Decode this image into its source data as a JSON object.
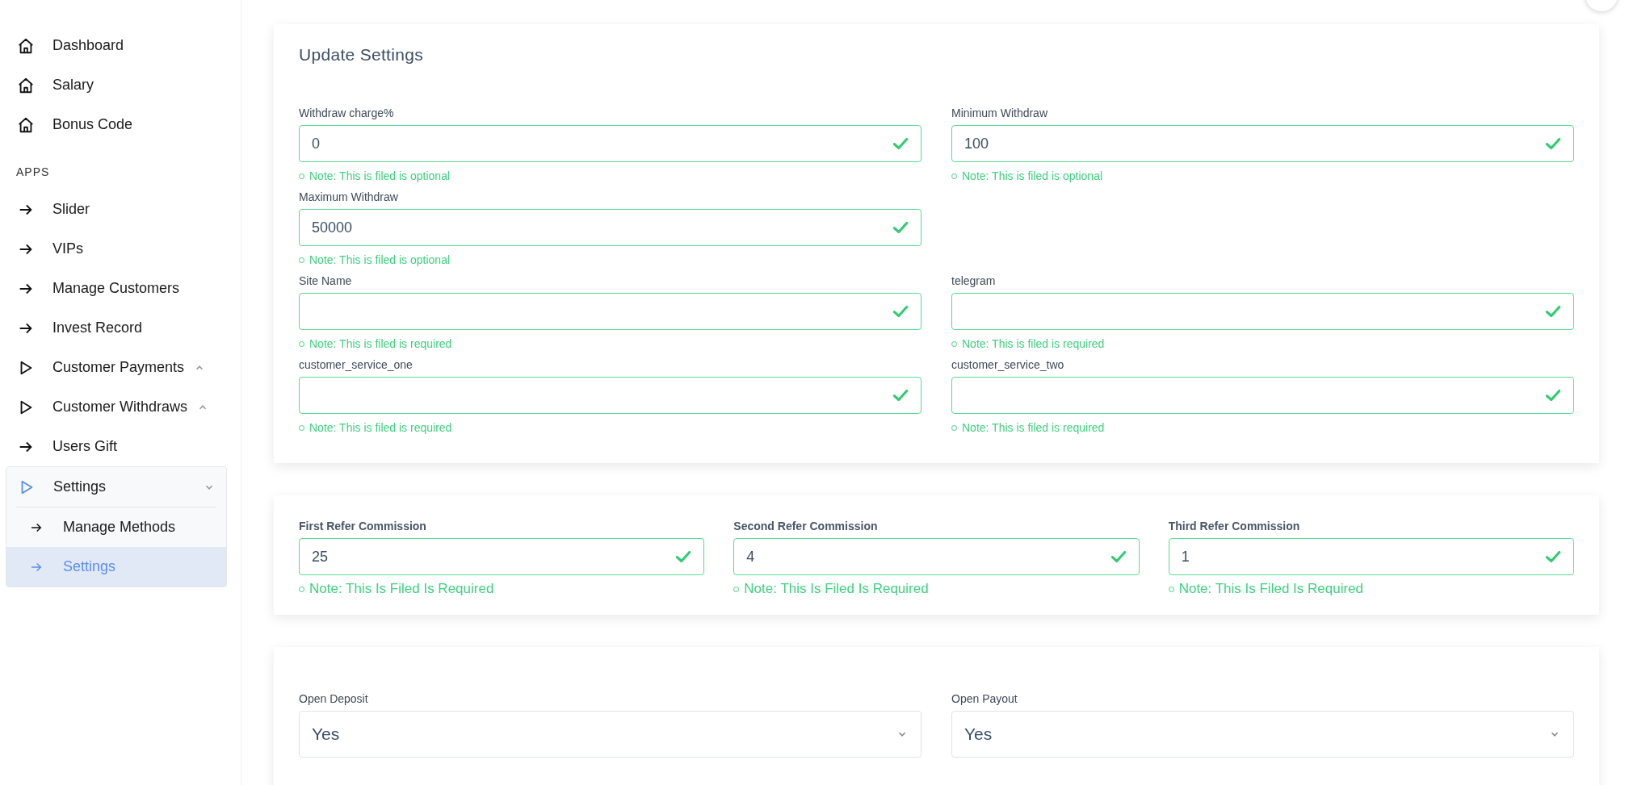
{
  "sidebar": {
    "items": [
      {
        "kind": "home",
        "label": "Dashboard"
      },
      {
        "kind": "home",
        "label": "Salary"
      },
      {
        "kind": "home",
        "label": "Bonus Code"
      },
      {
        "kind": "heading",
        "label": "APPS"
      },
      {
        "kind": "arrow",
        "label": "Slider"
      },
      {
        "kind": "arrow",
        "label": "VIPs"
      },
      {
        "kind": "arrow",
        "label": "Manage Customers"
      },
      {
        "kind": "arrow",
        "label": "Invest Record"
      },
      {
        "kind": "triangle",
        "label": "Customer Payments",
        "expanded": false
      },
      {
        "kind": "triangle",
        "label": "Customer Withdraws",
        "expanded": false
      },
      {
        "kind": "arrow",
        "label": "Users Gift"
      },
      {
        "kind": "triangle",
        "label": "Settings",
        "expanded": true,
        "children": [
          {
            "label": "Manage Methods",
            "selected": false
          },
          {
            "label": "Settings",
            "selected": true
          }
        ]
      }
    ]
  },
  "update_settings": {
    "title": "Update Settings",
    "rows": [
      [
        {
          "label": "Withdraw charge%",
          "value": "0",
          "valid": true,
          "note": "Note: This is filed is optional"
        },
        {
          "label": "Minimum Withdraw",
          "value": "100",
          "valid": true,
          "note": "Note: This is filed is optional"
        }
      ],
      [
        {
          "label": "Maximum Withdraw",
          "value": "50000",
          "valid": true,
          "note": "Note: This is filed is optional"
        }
      ],
      [
        {
          "label": "Site Name",
          "valid": true,
          "note": "Note: This is filed is required"
        },
        {
          "label": "telegram",
          "valid": true,
          "note": "Note: This is filed is required"
        }
      ],
      [
        {
          "label": "customer_service_one",
          "valid": true,
          "note": "Note: This is filed is required"
        },
        {
          "label": "customer_service_two",
          "valid": true,
          "note": "Note: This is filed is required"
        }
      ]
    ]
  },
  "commissions": [
    {
      "label": "First Refer Commission",
      "value": "25",
      "valid": true,
      "note": "Note: This Is Filed Is Required"
    },
    {
      "label": "Second Refer Commission",
      "value": "4",
      "valid": true,
      "note": "Note: This Is Filed Is Required"
    },
    {
      "label": "Third Refer Commission",
      "value": "1",
      "valid": true,
      "note": "Note: This Is Filed Is Required"
    }
  ],
  "toggles": [
    {
      "label": "Open Deposit",
      "value": "Yes"
    },
    {
      "label": "Open Payout",
      "value": "Yes"
    }
  ]
}
